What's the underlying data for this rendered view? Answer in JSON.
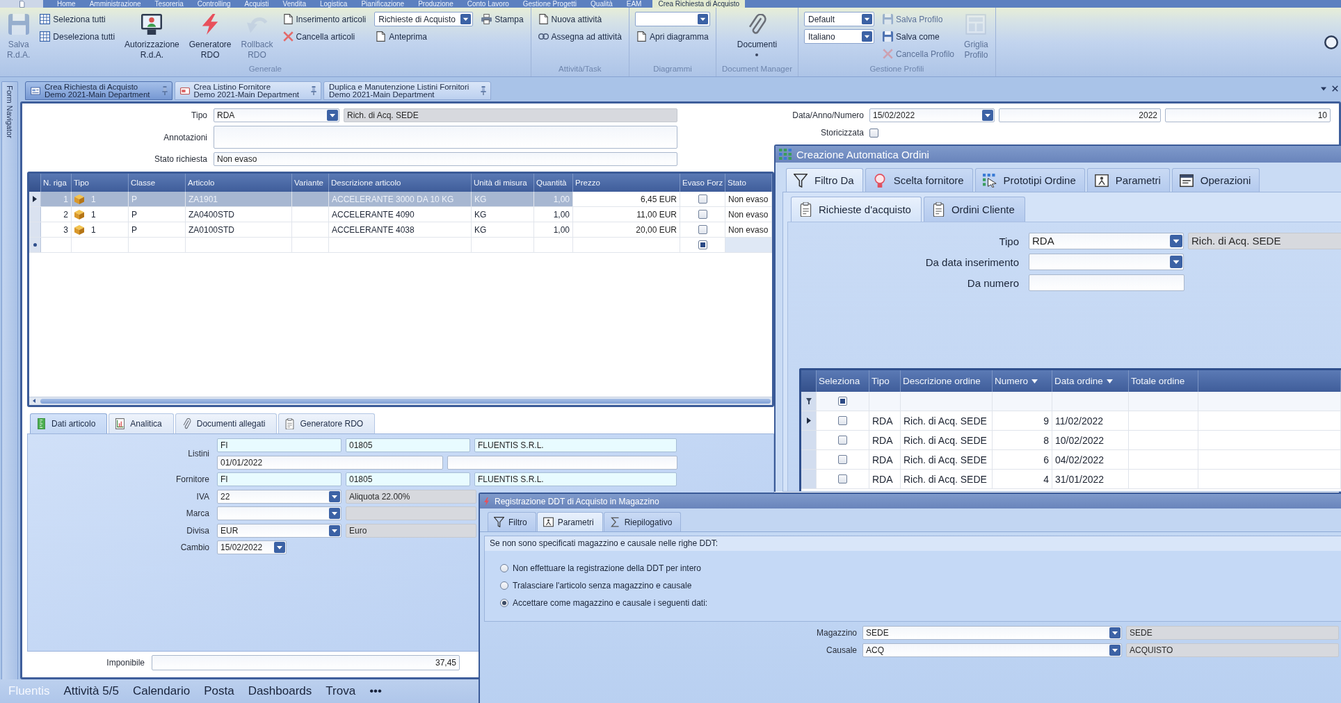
{
  "menu_bar": {
    "tabs": [
      {
        "label": "Home",
        "selected": false
      },
      {
        "label": "Amministrazione",
        "selected": false
      },
      {
        "label": "Tesoreria",
        "selected": false
      },
      {
        "label": "Controlling",
        "selected": false
      },
      {
        "label": "Acquisti",
        "selected": false
      },
      {
        "label": "Vendita",
        "selected": false
      },
      {
        "label": "Logistica",
        "selected": false
      },
      {
        "label": "Pianificazione",
        "selected": false
      },
      {
        "label": "Produzione",
        "selected": false
      },
      {
        "label": "Conto Lavoro",
        "selected": false
      },
      {
        "label": "Gestione Progetti",
        "selected": false
      },
      {
        "label": "Qualità",
        "selected": false
      },
      {
        "label": "EAM",
        "selected": false
      },
      {
        "label": "Crea Richiesta di Acquisto",
        "selected": true
      }
    ]
  },
  "ribbon": {
    "groups": [
      {
        "label": "Generale",
        "columns": [
          [
            {
              "kind": "large",
              "label": "Salva R.d.A.",
              "disabled": true,
              "has_menu": false
            }
          ],
          [
            {
              "kind": "small",
              "label": "Seleziona tutti",
              "disabled": false
            },
            {
              "kind": "small",
              "label": "Deseleziona tutti",
              "disabled": false
            }
          ],
          [
            {
              "kind": "large",
              "label": "Autorizzazione R.d.A.",
              "disabled": false,
              "has_menu": false
            }
          ],
          [
            {
              "kind": "large",
              "label": "Generatore RDO",
              "disabled": false,
              "has_menu": false
            }
          ],
          [
            {
              "kind": "large",
              "label": "Rollback RDO",
              "disabled": true,
              "has_menu": false
            }
          ],
          [
            {
              "kind": "small",
              "label": "Inserimento articoli",
              "disabled": false
            },
            {
              "kind": "small",
              "label": "Cancella articoli",
              "disabled": false
            }
          ],
          [
            {
              "kind": "dropdown",
              "value": "Richieste di Acquisto"
            },
            {
              "kind": "small",
              "label": "Anteprima",
              "disabled": false
            }
          ],
          [
            {
              "kind": "small",
              "label": "Stampa",
              "disabled": false
            }
          ]
        ]
      },
      {
        "label": "Attività/Task",
        "columns": [
          [
            {
              "kind": "small",
              "label": "Nuova attività",
              "disabled": false
            },
            {
              "kind": "small",
              "label": "Assegna ad attività",
              "disabled": false
            }
          ]
        ]
      },
      {
        "label": "Diagrammi",
        "columns": [
          [
            {
              "kind": "dropdown"
            },
            {
              "kind": "small",
              "label": "Apri diagramma",
              "disabled": false
            }
          ]
        ]
      },
      {
        "label": "Document Manager",
        "columns": [
          [
            {
              "kind": "large",
              "label": "Documenti",
              "disabled": false,
              "has_menu": true
            }
          ]
        ]
      },
      {
        "label": "Gestione Profili",
        "columns": [
          [
            {
              "kind": "dropdown",
              "value": "Default"
            },
            {
              "kind": "dropdown",
              "value": "Italiano"
            }
          ],
          [
            {
              "kind": "small",
              "label": "Salva Profilo",
              "disabled": true
            },
            {
              "kind": "small",
              "label": "Salva come",
              "disabled": false
            },
            {
              "kind": "small",
              "label": "Cancella Profilo",
              "disabled": true
            }
          ],
          [
            {
              "kind": "large",
              "label": "Griglia Profilo",
              "disabled": true,
              "has_menu": false
            }
          ]
        ]
      }
    ]
  },
  "document_tabs": [
    {
      "title": "Crea Richiesta di Acquisto",
      "subtitle": "Demo 2021-Main Department",
      "selected": true
    },
    {
      "title": "Crea Listino Fornitore",
      "subtitle": "Demo 2021-Main Department",
      "selected": false
    },
    {
      "title": "Duplica e Manutenzione Listini Fornitori",
      "subtitle": "Demo 2021-Main Department",
      "selected": false
    }
  ],
  "form_navigator": {
    "label": "Form Navigator"
  },
  "request_header": {
    "tipo": {
      "label": "Tipo",
      "value": "RDA",
      "description": "Rich. di Acq. SEDE"
    },
    "annotazioni": {
      "label": "Annotazioni"
    },
    "stato_richiesta": {
      "label": "Stato richiesta",
      "value": "Non evaso"
    },
    "data_anno_numero": {
      "label": "Data/Anno/Numero",
      "date": "15/02/2022",
      "year": "2022",
      "number": "10"
    },
    "storicizzata": {
      "label": "Storicizzata",
      "checked": false
    }
  },
  "articles_table": {
    "columns": [
      "N. riga",
      "Tipo",
      "Classe",
      "Articolo",
      "Variante",
      "Descrizione articolo",
      "Unità di misura",
      "Quantità",
      "Prezzo",
      "Evaso Forz",
      "Stato"
    ],
    "rows": [
      {
        "selected": true,
        "n_riga": "1",
        "tipo": "1",
        "classe": "P",
        "articolo": "ZA1901",
        "descrizione": "ACCELERANTE 3000 DA 10 KG",
        "unita": "KG",
        "quantita": "1,00",
        "prezzo": "6,45 EUR",
        "evaso_forz": false,
        "stato": "Non evaso"
      },
      {
        "selected": false,
        "n_riga": "2",
        "tipo": "1",
        "classe": "P",
        "articolo": "ZA0400STD",
        "descrizione": "ACCELERANTE 4090",
        "unita": "KG",
        "quantita": "1,00",
        "prezzo": "11,00 EUR",
        "evaso_forz": false,
        "stato": "Non evaso"
      },
      {
        "selected": false,
        "n_riga": "3",
        "tipo": "1",
        "classe": "P",
        "articolo": "ZA0100STD",
        "descrizione": "ACCELERANTE 4038",
        "unita": "KG",
        "quantita": "1,00",
        "prezzo": "20,00 EUR",
        "evaso_forz": false,
        "stato": "Non evaso"
      }
    ],
    "new_row": {
      "evaso_forz_indeterminate": true
    }
  },
  "detail_tabs": [
    {
      "label": "Dati articolo",
      "selected": true
    },
    {
      "label": "Analitica",
      "selected": false
    },
    {
      "label": "Documenti allegati",
      "selected": false
    },
    {
      "label": "Generatore RDO",
      "selected": false
    }
  ],
  "article_details": {
    "listini": {
      "label": "Listini",
      "code": "FI",
      "supplier_code": "01805",
      "supplier_name": "FLUENTIS S.R.L.",
      "date": "01/01/2022"
    },
    "fornitore": {
      "label": "Fornitore",
      "code": "FI",
      "supplier_code": "01805",
      "supplier_name": "FLUENTIS S.R.L."
    },
    "iva": {
      "label": "IVA",
      "value": "22",
      "description": "Aliquota 22.00%"
    },
    "marca": {
      "label": "Marca"
    },
    "divisa": {
      "label": "Divisa",
      "value": "EUR",
      "description": "Euro"
    },
    "cambio": {
      "label": "Cambio",
      "value": "15/02/2022"
    }
  },
  "imponibile": {
    "label": "Imponibile",
    "value": "37,45"
  },
  "order_window": {
    "title": "Creazione Automatica Ordini",
    "tabs": [
      {
        "label": "Filtro Da",
        "selected": true
      },
      {
        "label": "Scelta fornitore",
        "selected": false
      },
      {
        "label": "Prototipi Ordine",
        "selected": false
      },
      {
        "label": "Parametri",
        "selected": false
      },
      {
        "label": "Operazioni",
        "selected": false
      }
    ],
    "subtabs": [
      {
        "label": "Richieste d'acquisto",
        "selected": true
      },
      {
        "label": "Ordini Cliente",
        "selected": false
      }
    ],
    "filters": {
      "tipo": {
        "label": "Tipo",
        "value": "RDA",
        "description": "Rich. di Acq. SEDE"
      },
      "da_data": {
        "label": "Da data inserimento"
      },
      "da_numero": {
        "label": "Da numero"
      }
    },
    "grid": {
      "columns": [
        {
          "label": "Seleziona",
          "sortable": false
        },
        {
          "label": "Tipo",
          "sortable": false
        },
        {
          "label": "Descrizione ordine",
          "sortable": false
        },
        {
          "label": "Numero",
          "sortable": true
        },
        {
          "label": "Data ordine",
          "sortable": true
        },
        {
          "label": "Totale ordine",
          "sortable": false
        }
      ],
      "filter_row": {
        "select_all_indeterminate": true
      },
      "rows": [
        {
          "selected": true,
          "checked": false,
          "tipo": "RDA",
          "descrizione": "Rich. di Acq. SEDE",
          "numero": "9",
          "data": "11/02/2022"
        },
        {
          "selected": false,
          "checked": false,
          "tipo": "RDA",
          "descrizione": "Rich. di Acq. SEDE",
          "numero": "8",
          "data": "10/02/2022"
        },
        {
          "selected": false,
          "checked": false,
          "tipo": "RDA",
          "descrizione": "Rich. di Acq. SEDE",
          "numero": "6",
          "data": "04/02/2022"
        },
        {
          "selected": false,
          "checked": false,
          "tipo": "RDA",
          "descrizione": "Rich. di Acq. SEDE",
          "numero": "4",
          "data": "31/01/2022"
        }
      ]
    }
  },
  "ddt_dialog": {
    "title": "Registrazione DDT di Acquisto in Magazzino",
    "tabs": [
      {
        "label": "Filtro",
        "selected": false
      },
      {
        "label": "Parametri",
        "selected": true
      },
      {
        "label": "Riepilogativo",
        "selected": false
      }
    ],
    "group_title": "Se non sono specificati magazzino e causale nelle righe DDT:",
    "options": [
      {
        "label": "Non effettuare la registrazione della DDT per intero",
        "selected": false
      },
      {
        "label": "Tralasciare l'articolo senza magazzino e causale",
        "selected": false
      },
      {
        "label": "Accettare come magazzino e causale i seguenti dati:",
        "selected": true
      }
    ],
    "fields": [
      {
        "label": "Magazzino",
        "value": "SEDE",
        "description": "SEDE"
      },
      {
        "label": "Causale",
        "value": "ACQ",
        "description": "ACQUISTO"
      }
    ]
  },
  "bottom_nav": {
    "brand": "Fluentis",
    "items": [
      "Attività 5/5",
      "Calendario",
      "Posta",
      "Dashboards",
      "Trova"
    ],
    "more": "•••"
  }
}
